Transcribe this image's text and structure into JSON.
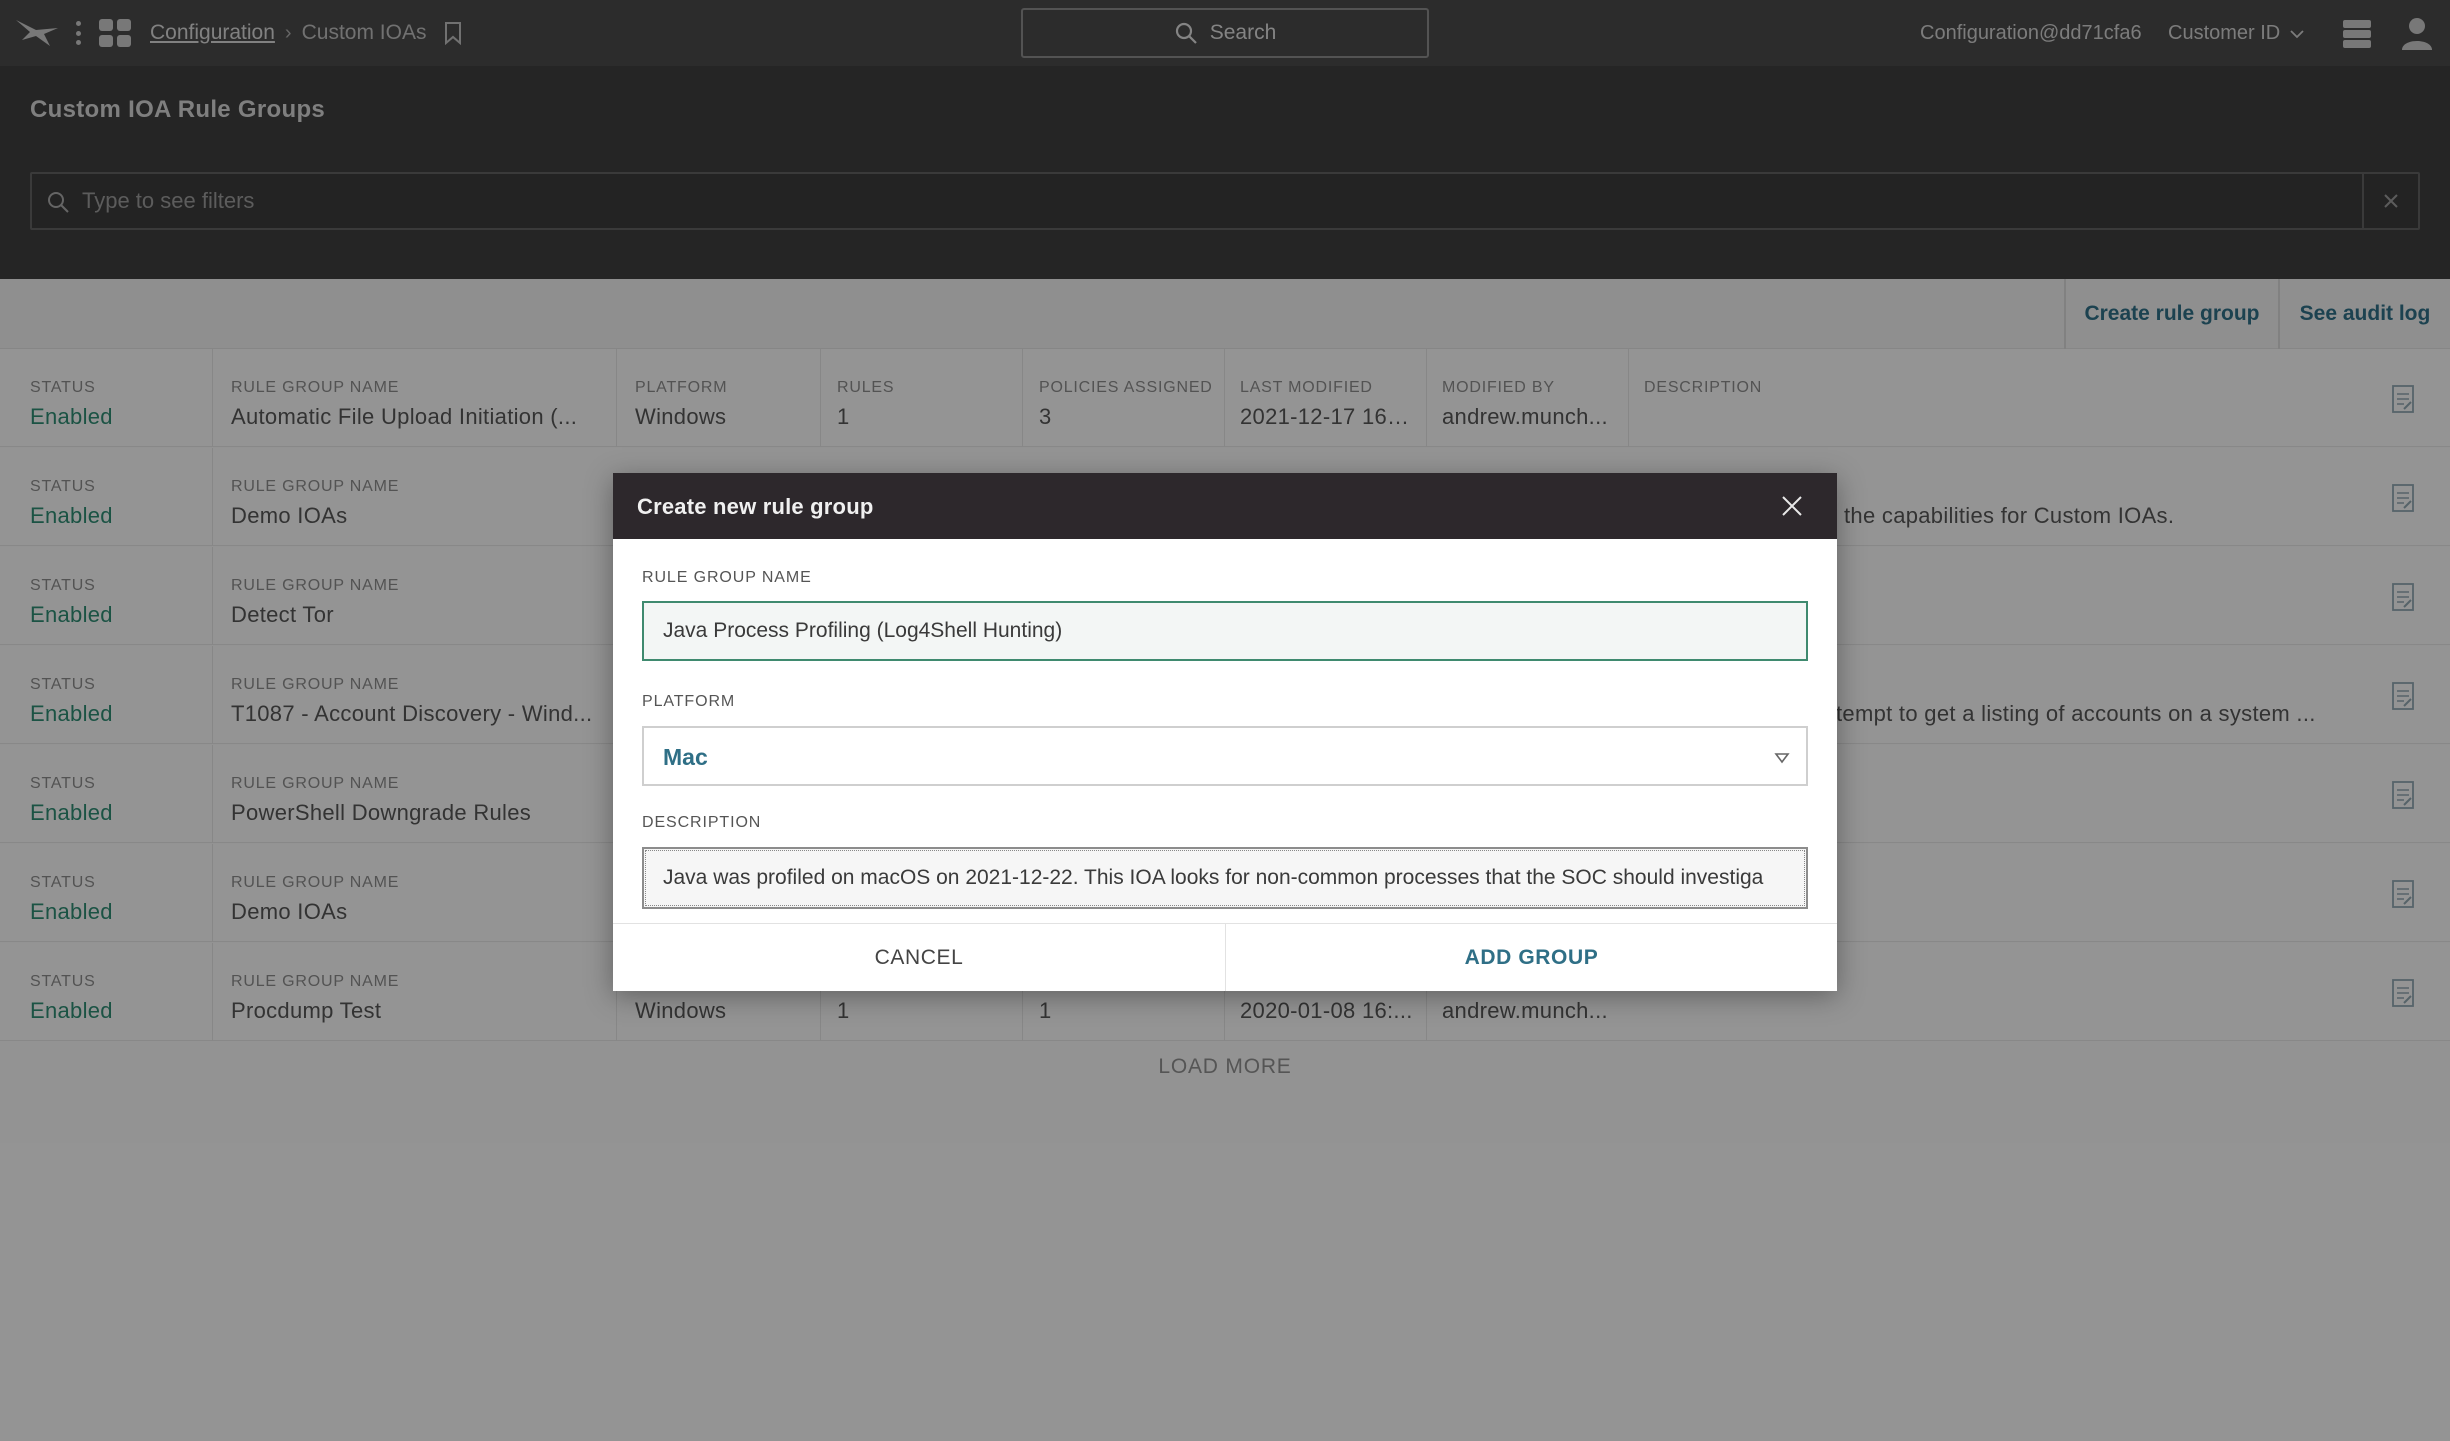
{
  "topbar": {
    "breadcrumb_root": "Configuration",
    "breadcrumb_current": "Custom IOAs",
    "search_label": "Search",
    "user_email": "Configuration@dd71cfa6",
    "customer_id_label": "Customer ID"
  },
  "page": {
    "title": "Custom IOA Rule Groups",
    "filter_placeholder": "Type to see filters",
    "create_rule_group": "Create rule group",
    "see_audit_log": "See audit log",
    "load_more": "LOAD MORE"
  },
  "table": {
    "labels": {
      "status": "STATUS",
      "rule_group_name": "RULE GROUP NAME",
      "platform": "PLATFORM",
      "rules": "RULES",
      "policies_assigned": "POLICIES ASSIGNED",
      "last_modified": "LAST MODIFIED",
      "modified_by": "MODIFIED BY",
      "description": "DESCRIPTION"
    },
    "rows": [
      {
        "status": "Enabled",
        "name": "Automatic File Upload Initiation (...",
        "platform": "Windows",
        "rules": "1",
        "policies": "3",
        "last_modified": "2021-12-17 16:3...",
        "modified_by": "andrew.munch...",
        "description": ""
      },
      {
        "status": "Enabled",
        "name": "Demo IOAs",
        "description": "the capabilities for Custom IOAs."
      },
      {
        "status": "Enabled",
        "name": "Detect Tor",
        "description": ""
      },
      {
        "status": "Enabled",
        "name": "T1087 - Account Discovery - Wind...",
        "description": "tempt to get a listing of accounts on a system ..."
      },
      {
        "status": "Enabled",
        "name": "PowerShell Downgrade Rules",
        "description": ""
      },
      {
        "status": "Enabled",
        "name": "Demo IOAs",
        "description": ""
      },
      {
        "status": "Enabled",
        "name": "Procdump Test",
        "platform": "Windows",
        "rules": "1",
        "policies": "1",
        "last_modified": "2020-01-08 16:...",
        "modified_by": "andrew.munch...",
        "description": ""
      }
    ]
  },
  "modal": {
    "title": "Create new rule group",
    "name_label": "RULE GROUP NAME",
    "name_value": "Java Process Profiling (Log4Shell Hunting)",
    "platform_label": "PLATFORM",
    "platform_value": "Mac",
    "description_label": "DESCRIPTION",
    "description_value": "Java was profiled on macOS on 2021-12-22. This IOA looks for non-common processes that the SOC should investiga",
    "cancel_label": "CANCEL",
    "add_label": "ADD GROUP"
  },
  "colors": {
    "topbar": "#4a4a4a",
    "header": "#3e3e3e",
    "enabled": "#2e8a72",
    "accent": "#2f6f86",
    "modal_head": "#2d282c"
  },
  "icons": [
    "falcon-logo-icon",
    "more-vertical-icon",
    "apps-grid-icon",
    "bookmark-icon",
    "search-icon",
    "chevron-down-icon",
    "stack-icon",
    "user-icon",
    "close-icon",
    "edit-document-icon"
  ]
}
